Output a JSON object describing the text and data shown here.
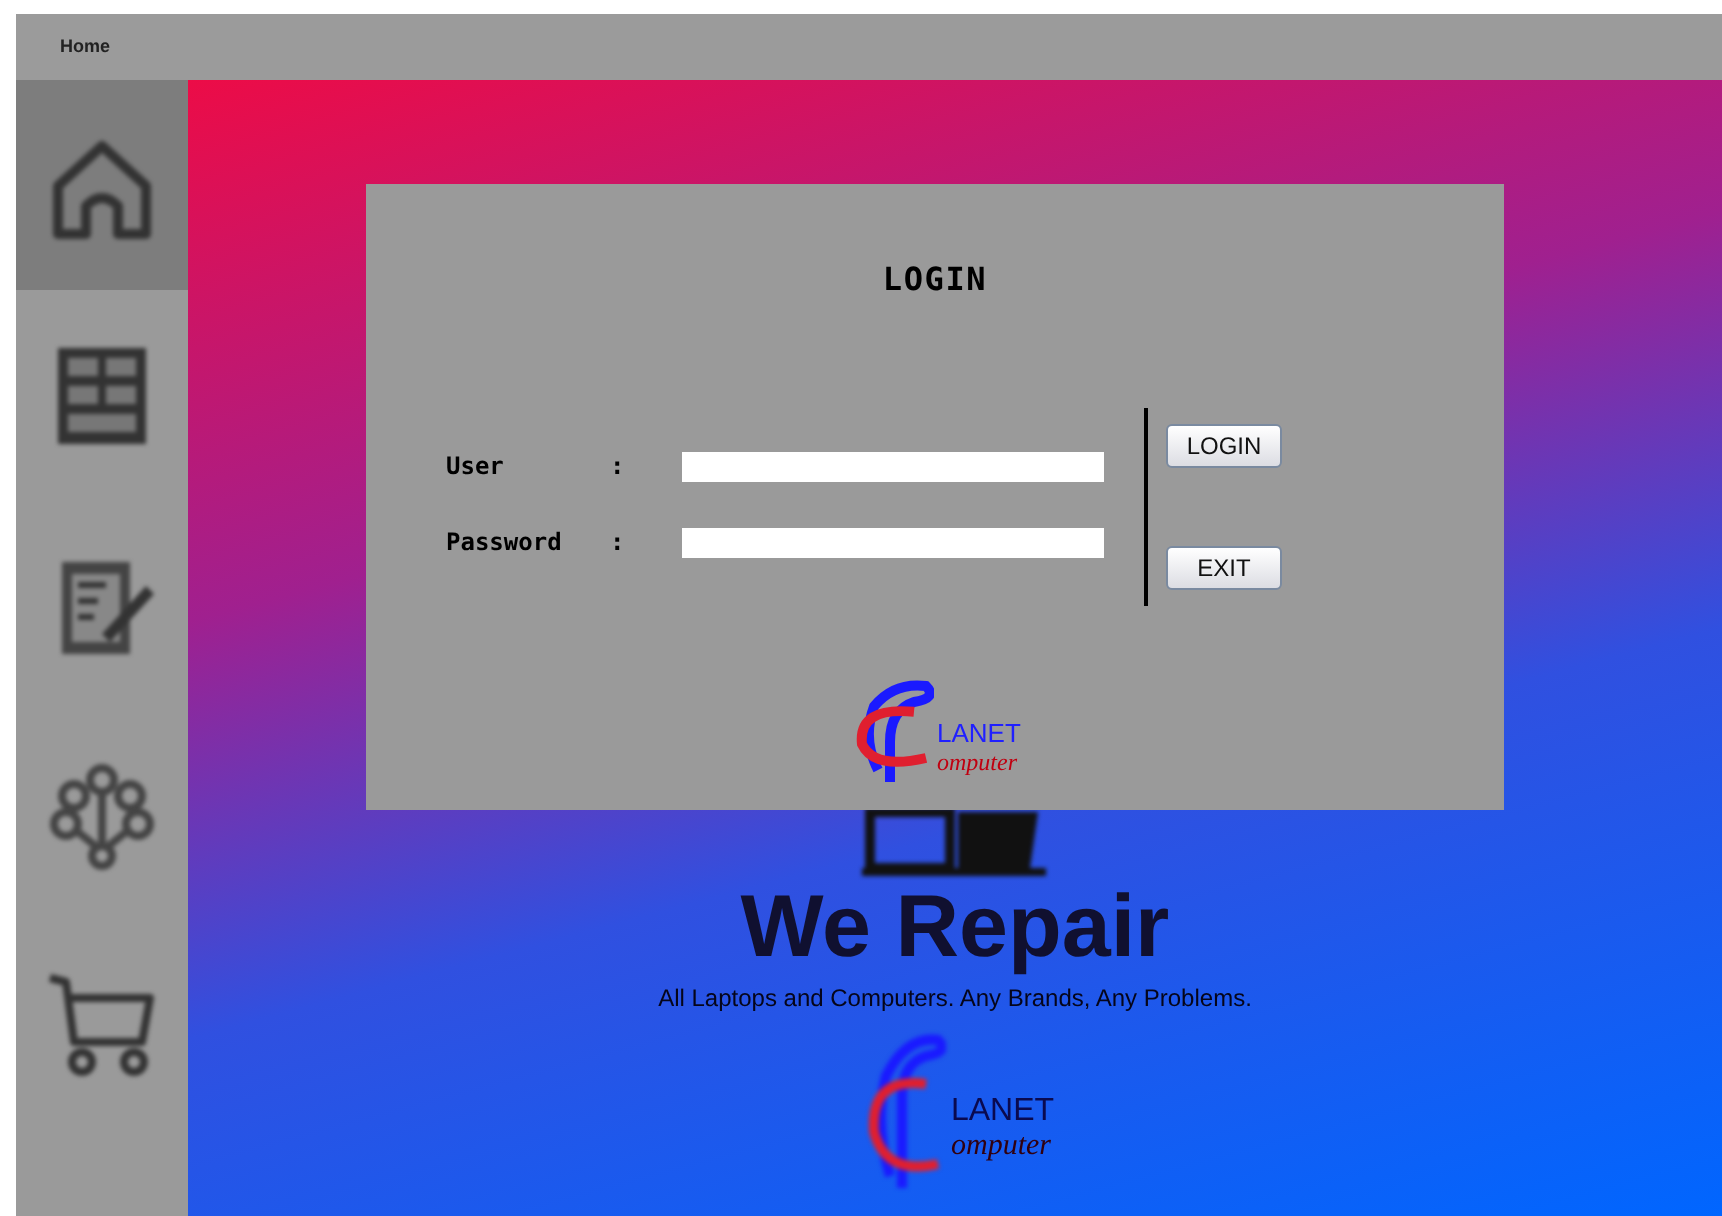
{
  "menu_bar": {
    "items": [
      {
        "label": "Home"
      }
    ]
  },
  "sidebar": {
    "items": [
      {
        "kind": "home",
        "selected": true
      },
      {
        "kind": "shelves",
        "selected": false
      },
      {
        "kind": "clipboard",
        "selected": false
      },
      {
        "kind": "network",
        "selected": false
      },
      {
        "kind": "cart",
        "selected": false
      }
    ]
  },
  "background": {
    "headline": "We Repair",
    "tagline": "All Laptops and Computers. Any Brands, Any Problems.",
    "logo": {
      "line_1": "LANET",
      "line_2": "omputer"
    }
  },
  "login_dialog": {
    "title": "LOGIN",
    "fields": [
      {
        "label": "User",
        "separator": ":"
      },
      {
        "label": "Password",
        "separator": ":"
      }
    ],
    "buttons": [
      "LOGIN",
      "EXIT"
    ],
    "logo": {
      "line_1": "LANET",
      "line_2": "omputer"
    }
  }
}
